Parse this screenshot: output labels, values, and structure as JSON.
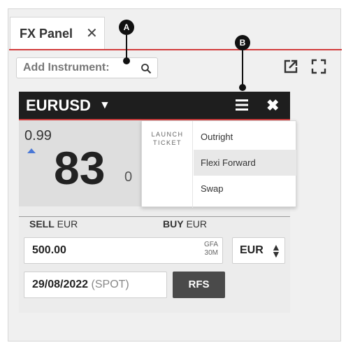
{
  "tab": {
    "label": "FX Panel",
    "close": "✕"
  },
  "search": {
    "label": "Add Instrument:",
    "icon": "search-icon"
  },
  "toolbar": {
    "popout_icon": "popout-icon",
    "fullscreen_icon": "fullscreen-icon"
  },
  "tile": {
    "pair": "EURUSD",
    "price_small": "0.99",
    "price_big": "83",
    "price_pip": "0",
    "menu_icon": "menu-icon",
    "close_icon": "close-icon"
  },
  "dropdown": {
    "launch_line1": "LAUNCH",
    "launch_line2": "TICKET",
    "options": [
      "Outright",
      "Flexi Forward",
      "Swap"
    ]
  },
  "trade": {
    "sell_bold": "SELL",
    "sell_ccy": "EUR",
    "buy_bold": "BUY",
    "buy_ccy": "EUR",
    "amount": "500.00",
    "gfa_line1": "GFA",
    "gfa_line2": "30M",
    "currency": "EUR",
    "date": "29/08/2022",
    "date_tenor": "(SPOT)",
    "rfs_label": "RFS"
  },
  "callouts": {
    "a": "A",
    "b": "B"
  },
  "colors": {
    "accent_red": "#d23c3c",
    "header_dark": "#1e1e1e",
    "uptick_blue": "#4a78d6"
  }
}
